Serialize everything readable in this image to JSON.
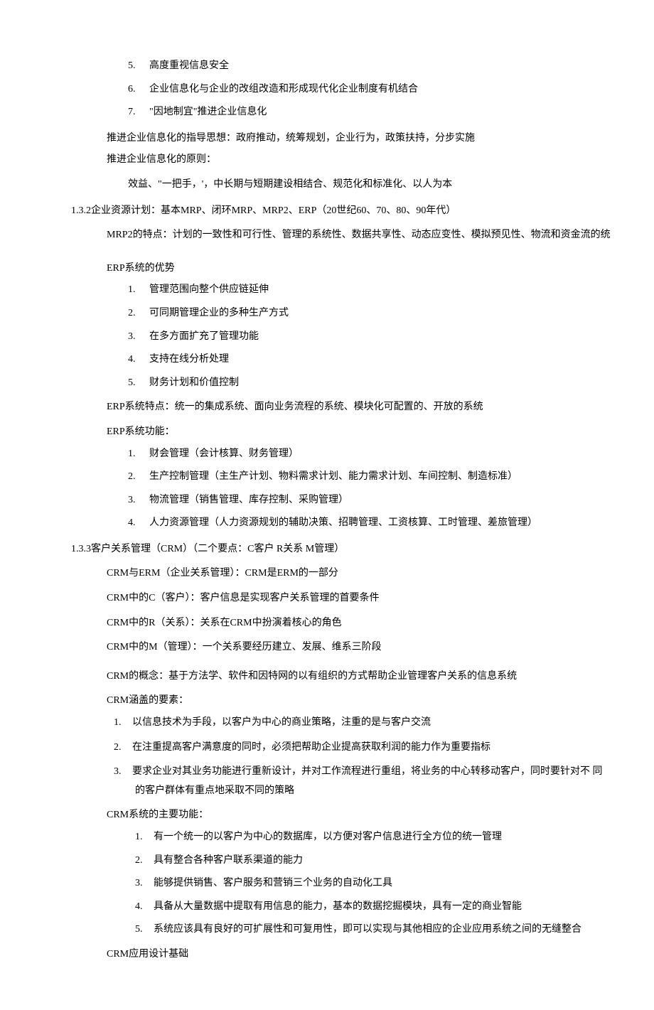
{
  "topList": [
    {
      "num": "5.",
      "text": "高度重视信息安全"
    },
    {
      "num": "6.",
      "text": "企业信息化与企业的改组改造和形成现代化企业制度有机结合"
    },
    {
      "num": "7.",
      "text": "\"因地制宜\"推进企业信息化"
    }
  ],
  "guideline": "推进企业信息化的指导思想：政府推动，统筹规划，企业行为，政策扶持，分步实施",
  "principleIntro": "推进企业信息化的原则：",
  "principleBody": "效益、\"一把手，'，中长期与短期建设相结合、规范化和标准化、以人为本",
  "s132_header": "1.3.2企业资源计划：基本MRP、闭环MRP、MRP2、ERP（20世纪60、70、80、90年代）",
  "mrp2": "MRP2的特点：计划的一致性和可行性、管理的系统性、数据共享性、动态应变性、模拟预见性、物流和资金流的统",
  "erpAdvTitle": "ERP系统的优势",
  "erpAdv": [
    {
      "num": "1.",
      "text": "管理范围向整个供应链延伸"
    },
    {
      "num": "2.",
      "text": "可同期管理企业的多种生产方式"
    },
    {
      "num": "3.",
      "text": "在多方面扩充了管理功能"
    },
    {
      "num": "4.",
      "text": "支持在线分析处理"
    },
    {
      "num": "5.",
      "text": "财务计划和价值控制"
    }
  ],
  "erpFeature": "ERP系统特点：统一的集成系统、面向业务流程的系统、模块化可配置的、开放的系统",
  "erpFuncTitle": "ERP系统功能：",
  "erpFunc": [
    {
      "num": "1.",
      "text": "财会管理（会计核算、财务管理）"
    },
    {
      "num": "2.",
      "text": "生产控制管理（主生产计划、物料需求计划、能力需求计划、车间控制、制造标准）"
    },
    {
      "num": "3.",
      "text": "物流管理（销售管理、库存控制、采购管理）"
    },
    {
      "num": "4.",
      "text": "人力资源管理（人力资源规划的辅助决策、招聘管理、工资核算、工时管理、差旅管理）"
    }
  ],
  "s133_header": "1.3.3客户关系管理（CRM）（二个要点：C客户 R关系 M管理）",
  "crmErm": "CRM与ERM（企业关系管理）：CRM是ERM的一部分",
  "crmC": "CRM中的C（客户）：客户信息是实现客户关系管理的首要条件",
  "crmR": "CRM中的R（关系）：关系在CRM中扮演着核心的角色",
  "crmM": "CRM中的M（管理）：一个关系要经历建立、发展、维系三阶段",
  "crmConcept": "CRM的概念：基于方法学、软件和因特网的以有组织的方式帮助企业管理客户关系的信息系统",
  "crmElemTitle": "CRM涵盖的要素：",
  "crmElem": [
    {
      "num": "1.",
      "text": "以信息技术为手段，以客户为中心的商业策略，注重的是与客户交流"
    },
    {
      "num": "2.",
      "text": "在注重提高客户满意度的同时，必须把帮助企业提高获取利润的能力作为重要指标"
    },
    {
      "num": "3.",
      "text": "要求企业对其业务功能进行重新设计，并对工作流程进行重组，将业务的中心转移动客户，同时要针对不 同的客户群体有重点地采取不同的策略"
    }
  ],
  "crmFuncTitle": "CRM系统的主要功能：",
  "crmFunc": [
    {
      "num": "1.",
      "text": "有一个统一的以客户为中心的数据库，以方便对客户信息进行全方位的统一管理"
    },
    {
      "num": "2.",
      "text": "具有整合各种客户联系渠道的能力"
    },
    {
      "num": "3.",
      "text": "能够提供销售、客户服务和营销三个业务的自动化工具"
    },
    {
      "num": "4.",
      "text": "具备从大量数据中提取有用信息的能力，基本的数据挖掘模块，具有一定的商业智能"
    },
    {
      "num": "5.",
      "text": "系统应该具有良好的可扩展性和可复用性，即可以实现与其他相应的企业应用系统之间的无缝整合"
    }
  ],
  "crmAppDesign": "CRM应用设计基础"
}
